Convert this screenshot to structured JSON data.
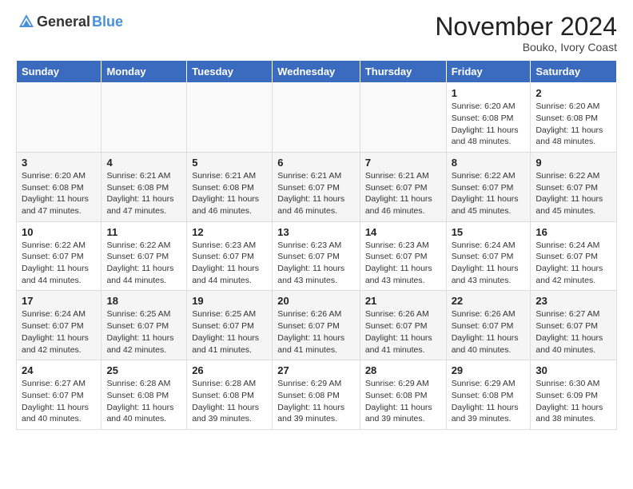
{
  "logo": {
    "general": "General",
    "blue": "Blue"
  },
  "header": {
    "month": "November 2024",
    "location": "Bouko, Ivory Coast"
  },
  "weekdays": [
    "Sunday",
    "Monday",
    "Tuesday",
    "Wednesday",
    "Thursday",
    "Friday",
    "Saturday"
  ],
  "weeks": [
    [
      {
        "day": "",
        "info": ""
      },
      {
        "day": "",
        "info": ""
      },
      {
        "day": "",
        "info": ""
      },
      {
        "day": "",
        "info": ""
      },
      {
        "day": "",
        "info": ""
      },
      {
        "day": "1",
        "info": "Sunrise: 6:20 AM\nSunset: 6:08 PM\nDaylight: 11 hours\nand 48 minutes."
      },
      {
        "day": "2",
        "info": "Sunrise: 6:20 AM\nSunset: 6:08 PM\nDaylight: 11 hours\nand 48 minutes."
      }
    ],
    [
      {
        "day": "3",
        "info": "Sunrise: 6:20 AM\nSunset: 6:08 PM\nDaylight: 11 hours\nand 47 minutes."
      },
      {
        "day": "4",
        "info": "Sunrise: 6:21 AM\nSunset: 6:08 PM\nDaylight: 11 hours\nand 47 minutes."
      },
      {
        "day": "5",
        "info": "Sunrise: 6:21 AM\nSunset: 6:08 PM\nDaylight: 11 hours\nand 46 minutes."
      },
      {
        "day": "6",
        "info": "Sunrise: 6:21 AM\nSunset: 6:07 PM\nDaylight: 11 hours\nand 46 minutes."
      },
      {
        "day": "7",
        "info": "Sunrise: 6:21 AM\nSunset: 6:07 PM\nDaylight: 11 hours\nand 46 minutes."
      },
      {
        "day": "8",
        "info": "Sunrise: 6:22 AM\nSunset: 6:07 PM\nDaylight: 11 hours\nand 45 minutes."
      },
      {
        "day": "9",
        "info": "Sunrise: 6:22 AM\nSunset: 6:07 PM\nDaylight: 11 hours\nand 45 minutes."
      }
    ],
    [
      {
        "day": "10",
        "info": "Sunrise: 6:22 AM\nSunset: 6:07 PM\nDaylight: 11 hours\nand 44 minutes."
      },
      {
        "day": "11",
        "info": "Sunrise: 6:22 AM\nSunset: 6:07 PM\nDaylight: 11 hours\nand 44 minutes."
      },
      {
        "day": "12",
        "info": "Sunrise: 6:23 AM\nSunset: 6:07 PM\nDaylight: 11 hours\nand 44 minutes."
      },
      {
        "day": "13",
        "info": "Sunrise: 6:23 AM\nSunset: 6:07 PM\nDaylight: 11 hours\nand 43 minutes."
      },
      {
        "day": "14",
        "info": "Sunrise: 6:23 AM\nSunset: 6:07 PM\nDaylight: 11 hours\nand 43 minutes."
      },
      {
        "day": "15",
        "info": "Sunrise: 6:24 AM\nSunset: 6:07 PM\nDaylight: 11 hours\nand 43 minutes."
      },
      {
        "day": "16",
        "info": "Sunrise: 6:24 AM\nSunset: 6:07 PM\nDaylight: 11 hours\nand 42 minutes."
      }
    ],
    [
      {
        "day": "17",
        "info": "Sunrise: 6:24 AM\nSunset: 6:07 PM\nDaylight: 11 hours\nand 42 minutes."
      },
      {
        "day": "18",
        "info": "Sunrise: 6:25 AM\nSunset: 6:07 PM\nDaylight: 11 hours\nand 42 minutes."
      },
      {
        "day": "19",
        "info": "Sunrise: 6:25 AM\nSunset: 6:07 PM\nDaylight: 11 hours\nand 41 minutes."
      },
      {
        "day": "20",
        "info": "Sunrise: 6:26 AM\nSunset: 6:07 PM\nDaylight: 11 hours\nand 41 minutes."
      },
      {
        "day": "21",
        "info": "Sunrise: 6:26 AM\nSunset: 6:07 PM\nDaylight: 11 hours\nand 41 minutes."
      },
      {
        "day": "22",
        "info": "Sunrise: 6:26 AM\nSunset: 6:07 PM\nDaylight: 11 hours\nand 40 minutes."
      },
      {
        "day": "23",
        "info": "Sunrise: 6:27 AM\nSunset: 6:07 PM\nDaylight: 11 hours\nand 40 minutes."
      }
    ],
    [
      {
        "day": "24",
        "info": "Sunrise: 6:27 AM\nSunset: 6:07 PM\nDaylight: 11 hours\nand 40 minutes."
      },
      {
        "day": "25",
        "info": "Sunrise: 6:28 AM\nSunset: 6:08 PM\nDaylight: 11 hours\nand 40 minutes."
      },
      {
        "day": "26",
        "info": "Sunrise: 6:28 AM\nSunset: 6:08 PM\nDaylight: 11 hours\nand 39 minutes."
      },
      {
        "day": "27",
        "info": "Sunrise: 6:29 AM\nSunset: 6:08 PM\nDaylight: 11 hours\nand 39 minutes."
      },
      {
        "day": "28",
        "info": "Sunrise: 6:29 AM\nSunset: 6:08 PM\nDaylight: 11 hours\nand 39 minutes."
      },
      {
        "day": "29",
        "info": "Sunrise: 6:29 AM\nSunset: 6:08 PM\nDaylight: 11 hours\nand 39 minutes."
      },
      {
        "day": "30",
        "info": "Sunrise: 6:30 AM\nSunset: 6:09 PM\nDaylight: 11 hours\nand 38 minutes."
      }
    ]
  ]
}
